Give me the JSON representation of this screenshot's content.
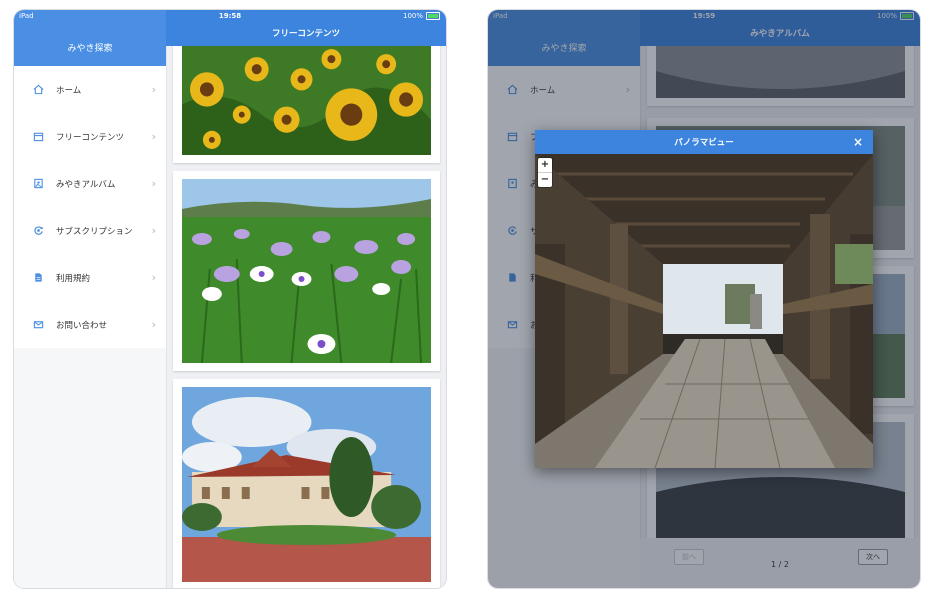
{
  "status_bar": {
    "carrier": "iPad",
    "battery": "100%"
  },
  "screen_left": {
    "time": "19:58",
    "sidebar_title": "みやき探索",
    "content_title": "フリーコンテンツ",
    "menu": [
      {
        "label": "ホーム",
        "icon": "home-icon"
      },
      {
        "label": "フリーコンテンツ",
        "icon": "calendar-icon"
      },
      {
        "label": "みやきアルバム",
        "icon": "photo-album-icon"
      },
      {
        "label": "サブスクリプション",
        "icon": "subscription-icon"
      },
      {
        "label": "利用規約",
        "icon": "document-icon"
      },
      {
        "label": "お問い合わせ",
        "icon": "mail-icon"
      }
    ]
  },
  "screen_right": {
    "time": "19:59",
    "sidebar_title": "みやき探索",
    "content_title": "みやきアルバム",
    "modal": {
      "title": "パノラマビュー",
      "zoom_in": "+",
      "zoom_out": "−"
    },
    "pager": {
      "prev": "前へ",
      "next": "次へ",
      "page": "1 / 2"
    }
  }
}
